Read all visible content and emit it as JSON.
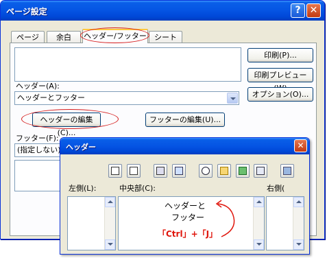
{
  "window": {
    "title": "ページ設定",
    "help_glyph": "?",
    "close_glyph": "✕"
  },
  "tabs": [
    {
      "label": "ページ"
    },
    {
      "label": "余白"
    },
    {
      "label": "ヘッダー/フッター",
      "selected": true
    },
    {
      "label": "シート"
    }
  ],
  "side_buttons": {
    "print": "印刷(P)...",
    "preview": "印刷プレビュー(W)",
    "options": "オプション(O)..."
  },
  "header": {
    "label": "ヘッダー(A):",
    "value": "ヘッダーとフッター"
  },
  "buttons": {
    "edit_header": "ヘッダーの編集(C)...",
    "edit_footer": "フッターの編集(U)..."
  },
  "footer": {
    "label": "フッター(F):",
    "value": "(指定しない)"
  },
  "header_dialog": {
    "title": "ヘッダー",
    "close_glyph": "✕",
    "toolbar_icons": [
      "format-text-icon",
      "page-number-icon",
      "total-pages-icon",
      "date-icon",
      "time-icon",
      "file-path-icon",
      "file-name-icon",
      "sheet-name-icon",
      "insert-picture-icon"
    ],
    "left_label": "左側(L):",
    "center_label": "中央部(C):",
    "right_label": "右側(",
    "center_text_line1": "ヘッダーと",
    "center_text_line2": "フッター",
    "annotation": "「Ctrl」+「J」"
  },
  "colors": {
    "titlebar": "#0554e3",
    "annotation_red": "#e0160c",
    "dialog_bg": "#ece9d8"
  }
}
